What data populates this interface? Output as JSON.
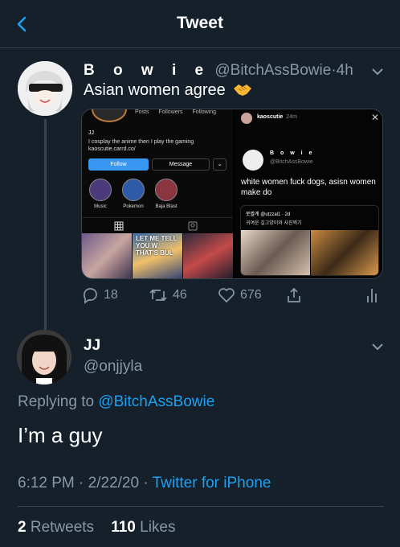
{
  "header": {
    "title": "Tweet",
    "back_icon": "chevron-left-icon"
  },
  "tweet": {
    "display_name": "B o w i e",
    "handle": "@BitchAssBowie",
    "separator": "·",
    "time": "4h",
    "text": "Asian women agree",
    "emoji": "handshake",
    "media": {
      "left": {
        "stats": [
          "Posts",
          "Followers",
          "Following"
        ],
        "profile_name": "JJ",
        "bio_line1": "I cosplay the anime then I play the gaming",
        "bio_line2": "kaoscutie.carrd.co/",
        "follow_label": "Follow",
        "message_label": "Message",
        "more_label": "⌄",
        "highlights": [
          "Music",
          "Pokemon",
          "Baja Blast"
        ],
        "grid_overlay_text": [
          "LET ME TELL YOU W",
          "THAT'S BUL"
        ]
      },
      "right": {
        "username": "kaoscutie",
        "age": "24m",
        "close": "✕",
        "quoted_name": "B o w i e",
        "quoted_handle": "@BitchAssBowie",
        "quoted_text": "white women fuck dogs, asisn women make do",
        "inner_user": "못짤계 @utzzal1 · 2d",
        "inner_text": "귀여운 길고양이와 사진찍기"
      }
    },
    "actions": {
      "replies": "18",
      "retweets": "46",
      "likes": "676"
    }
  },
  "reply": {
    "display_name": "JJ",
    "handle": "@onjjyla",
    "replying_prefix": "Replying to ",
    "replying_to": "@BitchAssBowie",
    "text": "I’m a guy",
    "time": "6:12 PM",
    "sep1": "·",
    "date": "2/22/20",
    "sep2": "·",
    "source": "Twitter for iPhone",
    "retweet_count": "2",
    "retweet_label": "Retweets",
    "like_count": "110",
    "like_label": "Likes"
  },
  "colors": {
    "background": "#15202b",
    "accent": "#1da1f2",
    "muted": "#8899a6",
    "border": "#38444d"
  }
}
